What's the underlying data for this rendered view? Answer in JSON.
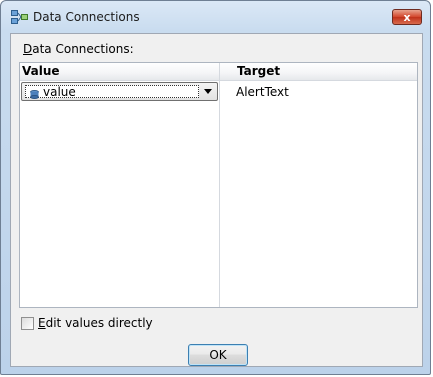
{
  "window": {
    "title": "Data Connections",
    "close_glyph": "x"
  },
  "dialog": {
    "section_label": "Data Connections:",
    "columns": [
      "Value",
      "Target"
    ],
    "rows": [
      {
        "value": "value",
        "target": "AlertText"
      }
    ],
    "edit_directly_label": "Edit values directly",
    "edit_directly_checked": false,
    "ok_label": "OK"
  },
  "icons": {
    "title": "data-connections-icon",
    "row_value": "database-icon",
    "dropdown": "chevron-down-icon"
  }
}
